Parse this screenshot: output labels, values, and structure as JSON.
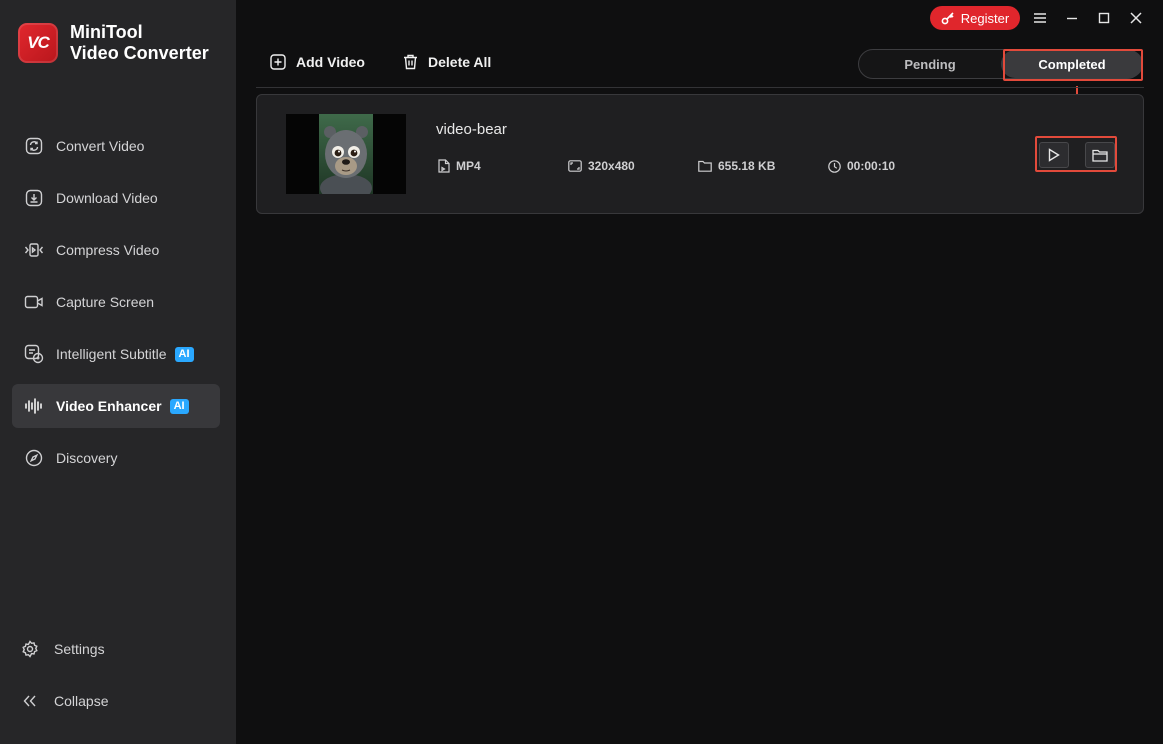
{
  "app": {
    "brand_line1": "MiniTool",
    "brand_line2": "Video Converter",
    "logo_text": "VC",
    "accent_color": "#e0262c"
  },
  "titlebar": {
    "register_label": "Register"
  },
  "sidebar": {
    "items": [
      {
        "label": "Convert Video",
        "icon": "convert-icon"
      },
      {
        "label": "Download Video",
        "icon": "download-icon"
      },
      {
        "label": "Compress Video",
        "icon": "compress-icon"
      },
      {
        "label": "Capture Screen",
        "icon": "camera-icon"
      },
      {
        "label": "Intelligent Subtitle",
        "icon": "subtitle-icon",
        "badge": "AI"
      },
      {
        "label": "Video Enhancer",
        "icon": "waveform-icon",
        "badge": "AI",
        "active": true
      },
      {
        "label": "Discovery",
        "icon": "compass-icon"
      }
    ],
    "settings_label": "Settings",
    "collapse_label": "Collapse"
  },
  "toolbar": {
    "add_video_label": "Add Video",
    "delete_all_label": "Delete All"
  },
  "tabs": {
    "pending_label": "Pending",
    "completed_label": "Completed",
    "selected": "Completed"
  },
  "video": {
    "name": "video-bear",
    "format": "MP4",
    "resolution": "320x480",
    "size": "655.18 KB",
    "duration": "00:00:10"
  }
}
